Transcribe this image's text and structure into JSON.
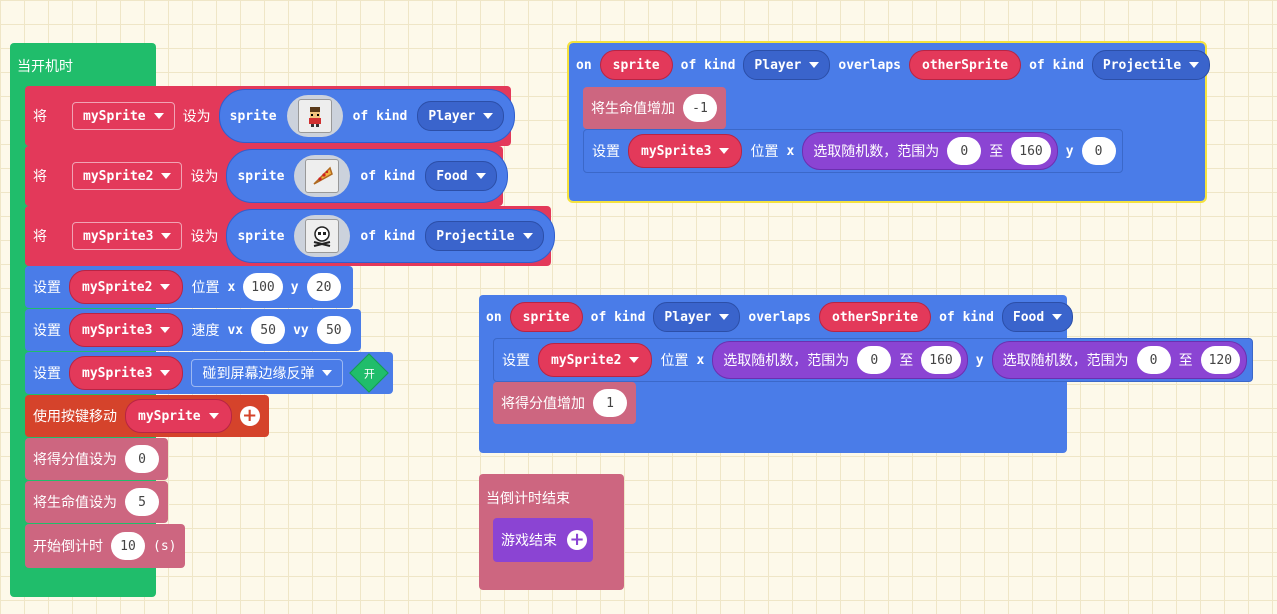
{
  "on_start": {
    "hat_label": "当开机时",
    "set_label": "将",
    "set_to_label": "设为",
    "sprite_label": "sprite",
    "of_kind_label": "of kind",
    "sprites": [
      {
        "var": "mySprite",
        "kind": "Player",
        "image_icon": "player-sprite-image"
      },
      {
        "var": "mySprite2",
        "kind": "Food",
        "image_icon": "pizza-sprite-image"
      },
      {
        "var": "mySprite3",
        "kind": "Projectile",
        "image_icon": "skull-sprite-image"
      }
    ],
    "set_position": {
      "label": "设置",
      "var": "mySprite2",
      "prop": "位置",
      "x_label": "x",
      "x": "100",
      "y_label": "y",
      "y": "20"
    },
    "set_velocity": {
      "label": "设置",
      "var": "mySprite3",
      "prop": "速度",
      "vx_label": "vx",
      "vx": "50",
      "vy_label": "vy",
      "vy": "50"
    },
    "set_bounce": {
      "label": "设置",
      "var": "mySprite3",
      "flag": "碰到屏幕边缘反弹",
      "toggle": "开"
    },
    "move_buttons": {
      "label": "使用按键移动",
      "var": "mySprite"
    },
    "set_score": {
      "label": "将得分值设为",
      "value": "0"
    },
    "set_life": {
      "label": "将生命值设为",
      "value": "5"
    },
    "countdown": {
      "label": "开始倒计时",
      "value": "10",
      "unit": "(s)"
    }
  },
  "overlap_projectile": {
    "on": "on",
    "sprite": "sprite",
    "of_kind": "of kind",
    "kind1": "Player",
    "overlaps": "overlaps",
    "other": "otherSprite",
    "kind2": "Projectile",
    "change_life": {
      "label": "将生命值增加",
      "value": "-1"
    },
    "set_pos": {
      "label": "设置",
      "var": "mySprite3",
      "prop": "位置",
      "x_label": "x",
      "rand_label": "选取随机数，范围为",
      "from": "0",
      "to_label": "至",
      "to": "160",
      "y_label": "y",
      "y": "0"
    }
  },
  "overlap_food": {
    "on": "on",
    "sprite": "sprite",
    "of_kind": "of kind",
    "kind1": "Player",
    "overlaps": "overlaps",
    "other": "otherSprite",
    "kind2": "Food",
    "set_pos": {
      "label": "设置",
      "var": "mySprite2",
      "prop": "位置",
      "x_label": "x",
      "rand_label": "选取随机数，范围为",
      "x_from": "0",
      "to_label": "至",
      "x_to": "160",
      "y_label": "y",
      "y_from": "0",
      "y_to": "120"
    },
    "change_score": {
      "label": "将得分值增加",
      "value": "1"
    }
  },
  "countdown_end": {
    "hat_label": "当倒计时结束",
    "game_over": "游戏结束"
  },
  "colors": {
    "event_green": "#20bd6b",
    "sprites_red": "#e3395a",
    "sprites_blue": "#4a7ce8",
    "controller_orange": "#d5432b",
    "info_pink": "#cd6680",
    "math_purple": "#8b44d3",
    "selection_yellow": "#f4e23e"
  }
}
